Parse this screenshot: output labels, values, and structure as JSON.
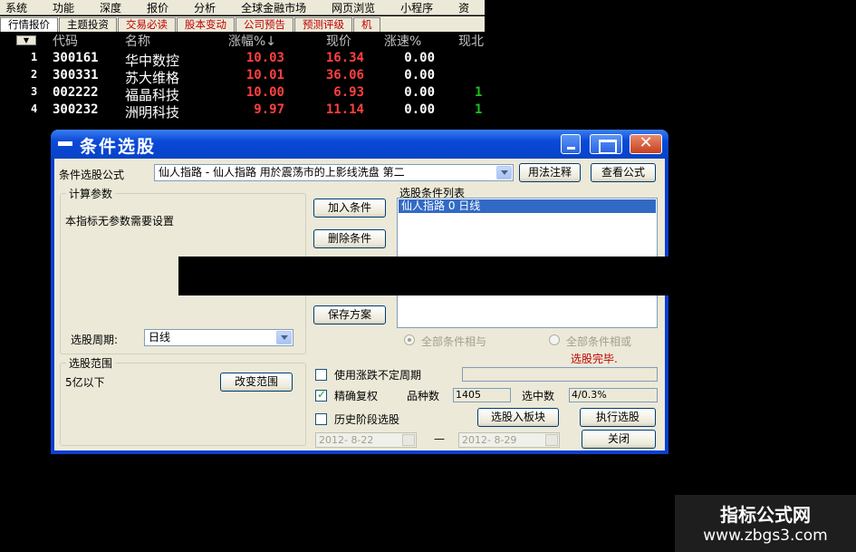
{
  "app": {
    "menu": [
      "系统",
      "功能",
      "深度",
      "报价",
      "分析",
      "全球金融市场",
      "网页浏览",
      "小程序",
      "资"
    ],
    "tabs": [
      "行情报价",
      "主题投资",
      "交易必读",
      "股本变动",
      "公司预告",
      "预测评级",
      "机"
    ],
    "quote_header": {
      "code": "代码",
      "name": "名称",
      "change": "涨幅%↓",
      "price": "现价",
      "speed": "涨速%",
      "cur": "现北"
    },
    "rows": [
      {
        "idx": "1",
        "code": "300161",
        "name": "华中数控",
        "change": "10.03",
        "price": "16.34",
        "speed": "0.00",
        "cur": ""
      },
      {
        "idx": "2",
        "code": "300331",
        "name": "苏大维格",
        "change": "10.01",
        "price": "36.06",
        "speed": "0.00",
        "cur": ""
      },
      {
        "idx": "3",
        "code": "002222",
        "name": "福晶科技",
        "change": "10.00",
        "price": "6.93",
        "speed": "0.00",
        "cur": "1"
      },
      {
        "idx": "4",
        "code": "300232",
        "name": "洲明科技",
        "change": "9.97",
        "price": "11.14",
        "speed": "0.00",
        "cur": "1"
      }
    ]
  },
  "dialog": {
    "title": "条件选股",
    "formula_label": "条件选股公式",
    "formula_value": "仙人指路 - 仙人指路 用於震荡市的上影线洗盘 第二",
    "usage_button": "用法注释",
    "view_button": "查看公式",
    "calc_params_title": "计算参数",
    "no_params_text": "本指标无参数需要设置",
    "add_condition": "加入条件",
    "delete_condition": "删除条件",
    "save_plan": "保存方案",
    "condition_list_title": "选股条件列表",
    "condition_list": [
      "仙人指路  0  日线"
    ],
    "period_label": "选股周期:",
    "period_value": "日线",
    "all_and": "全部条件相与",
    "all_or": "全部条件相或",
    "status": "选股完毕.",
    "range_title": "选股范围",
    "range_value": "5亿以下",
    "change_range": "改变范围",
    "use_uncertain_period": "使用涨跌不定周期",
    "exact_rights": "精确复权",
    "variety_label": "品种数",
    "variety_value": "1405",
    "selected_label": "选中数",
    "selected_value": "4/0.3%",
    "history_stage": "历史阶段选股",
    "to_board": "选股入板块",
    "execute": "执行选股",
    "close": "关闭",
    "date_from": "2012- 8-22",
    "date_sep": "—",
    "date_to": "2012- 8-29"
  },
  "watermark": {
    "line1": "指标公式网",
    "line2": "www.zbgs3.com"
  },
  "colors": {
    "dialog_blue": "#0a3fd1",
    "selection": "#316ac5",
    "up_red": "#ff4040",
    "status_red": "#c00000"
  }
}
